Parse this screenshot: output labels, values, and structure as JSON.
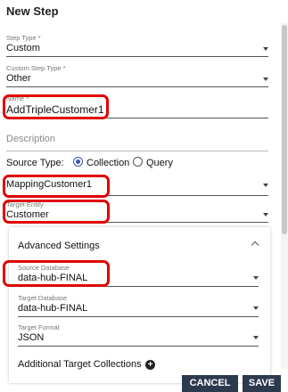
{
  "dialog": {
    "title": "New Step"
  },
  "step_type": {
    "label": "Step Type *",
    "value": "Custom"
  },
  "custom_step_type": {
    "label": "Custom Step Type *",
    "value": "Other"
  },
  "name": {
    "label": "Name *",
    "value": "AddTripleCustomer1"
  },
  "description": {
    "placeholder": "Description"
  },
  "source_type": {
    "label": "Source Type:",
    "options": [
      {
        "label": "Collection",
        "selected": true
      },
      {
        "label": "Query",
        "selected": false
      }
    ]
  },
  "mapping": {
    "value": "MappingCustomer1"
  },
  "target_entity": {
    "label": "Target Entity",
    "value": "Customer"
  },
  "advanced": {
    "title": "Advanced Settings",
    "source_database": {
      "label": "Source Database",
      "value": "data-hub-FINAL"
    },
    "target_database": {
      "label": "Target Database",
      "value": "data-hub-FINAL"
    },
    "target_format": {
      "label": "Target Format",
      "value": "JSON"
    },
    "additional_collections": {
      "label": "Additional Target Collections"
    }
  },
  "footer": {
    "cancel_label": "CANCEL",
    "save_label": "SAVE"
  },
  "colors": {
    "highlight": "#e10000",
    "button_bg": "#2d3a4e",
    "radio_accent": "#3f51b5"
  }
}
